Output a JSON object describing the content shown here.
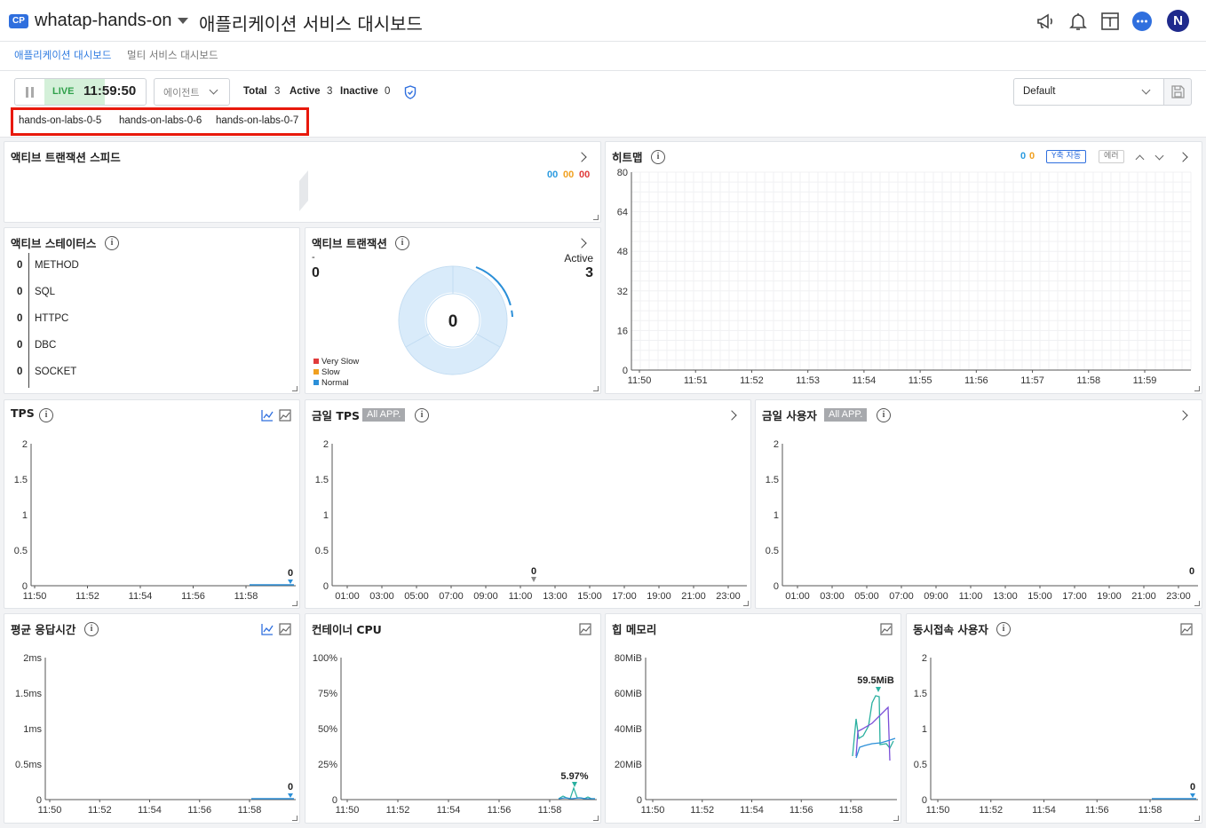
{
  "header": {
    "badge": "CP",
    "project": "whatap-hands-on",
    "title": "애플리케이션 서비스 대시보드",
    "avatar": "N"
  },
  "subnav": {
    "tabs": [
      {
        "label": "애플리케이션 대시보드",
        "active": true
      },
      {
        "label": "멀티 서비스 대시보드",
        "active": false
      }
    ]
  },
  "toolbar": {
    "live": "LIVE",
    "time": "11:59:50",
    "agent_select": "에이전트",
    "total_label": "Total",
    "total_value": "3",
    "active_label": "Active",
    "active_value": "3",
    "inactive_label": "Inactive",
    "inactive_value": "0",
    "agents": [
      "hands-on-labs-0-5",
      "hands-on-labs-0-6",
      "hands-on-labs-0-7"
    ],
    "layout_select": "Default"
  },
  "speed": {
    "title": "액티브 트랜잭션 스피드",
    "counts": [
      "00",
      "00",
      "00"
    ]
  },
  "status": {
    "title": "액티브 스테이터스",
    "rows": [
      {
        "value": "0",
        "label": "METHOD"
      },
      {
        "value": "0",
        "label": "SQL"
      },
      {
        "value": "0",
        "label": "HTTPC"
      },
      {
        "value": "0",
        "label": "DBC"
      },
      {
        "value": "0",
        "label": "SOCKET"
      }
    ]
  },
  "active_tx": {
    "title": "액티브 트랜잭션",
    "dash": "-",
    "left_value": "0",
    "active_label": "Active",
    "active_value": "3",
    "center_value": "0",
    "legend": [
      {
        "label": "Very Slow",
        "color": "#e03b3b"
      },
      {
        "label": "Slow",
        "color": "#f0a020"
      },
      {
        "label": "Normal",
        "color": "#2b8fd8"
      }
    ]
  },
  "heatmap": {
    "title": "히트맵",
    "count1": "0",
    "count2": "0",
    "y_auto": "Y축 자동",
    "error": "에러",
    "y_ticks": [
      "80",
      "64",
      "48",
      "32",
      "16",
      "0"
    ],
    "x_ticks": [
      "11:50",
      "11:51",
      "11:52",
      "11:53",
      "11:54",
      "11:55",
      "11:56",
      "11:57",
      "11:58",
      "11:59"
    ]
  },
  "tps": {
    "title": "TPS",
    "y_ticks": [
      "2",
      "1.5",
      "1",
      "0.5",
      "0"
    ],
    "x_ticks": [
      "11:50",
      "11:52",
      "11:54",
      "11:56",
      "11:58"
    ],
    "last_value": "0"
  },
  "today_tps": {
    "title": "금일 TPS",
    "badge": "All APP.",
    "y_ticks": [
      "2",
      "1.5",
      "1",
      "0.5",
      "0"
    ],
    "x_ticks": [
      "01:00",
      "03:00",
      "05:00",
      "07:00",
      "09:00",
      "11:00",
      "13:00",
      "15:00",
      "17:00",
      "19:00",
      "21:00",
      "23:00"
    ],
    "marker_value": "0"
  },
  "today_users": {
    "title": "금일 사용자",
    "badge": "All APP.",
    "y_ticks": [
      "2",
      "1.5",
      "1",
      "0.5",
      "0"
    ],
    "x_ticks": [
      "01:00",
      "03:00",
      "05:00",
      "07:00",
      "09:00",
      "11:00",
      "13:00",
      "15:00",
      "17:00",
      "19:00",
      "21:00",
      "23:00"
    ],
    "last_value": "0"
  },
  "resp_time": {
    "title": "평균 응답시간",
    "y_ticks": [
      "2ms",
      "1.5ms",
      "1ms",
      "0.5ms",
      "0"
    ],
    "x_ticks": [
      "11:50",
      "11:52",
      "11:54",
      "11:56",
      "11:58"
    ],
    "last_value": "0"
  },
  "cpu": {
    "title": "컨테이너 CPU",
    "y_ticks": [
      "100%",
      "75%",
      "50%",
      "25%",
      "0"
    ],
    "x_ticks": [
      "11:50",
      "11:52",
      "11:54",
      "11:56",
      "11:58"
    ],
    "peak_label": "5.97%"
  },
  "heap": {
    "title": "힙 메모리",
    "y_ticks": [
      "80MiB",
      "60MiB",
      "40MiB",
      "20MiB",
      "0"
    ],
    "x_ticks": [
      "11:50",
      "11:52",
      "11:54",
      "11:56",
      "11:58"
    ],
    "peak_label": "59.5MiB"
  },
  "concurrent": {
    "title": "동시접속 사용자",
    "y_ticks": [
      "2",
      "1.5",
      "1",
      "0.5",
      "0"
    ],
    "x_ticks": [
      "11:50",
      "11:52",
      "11:54",
      "11:56",
      "11:58"
    ],
    "last_value": "0"
  }
}
